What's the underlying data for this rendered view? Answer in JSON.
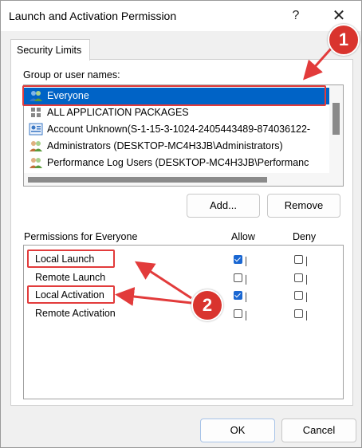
{
  "window": {
    "title": "Launch and Activation Permission",
    "help_glyph": "?",
    "close_glyph": "✕"
  },
  "tabs": [
    {
      "label": "Security Limits"
    }
  ],
  "group_section": {
    "label": "Group or user names:",
    "items": [
      {
        "label": "Everyone",
        "icon": "users-group-icon",
        "selected": true
      },
      {
        "label": "ALL APPLICATION PACKAGES",
        "icon": "packages-grid-icon",
        "selected": false
      },
      {
        "label": "Account Unknown(S-1-15-3-1024-2405443489-874036122-",
        "icon": "unknown-account-icon",
        "selected": false
      },
      {
        "label": "Administrators (DESKTOP-MC4H3JB\\Administrators)",
        "icon": "users-group-icon",
        "selected": false
      },
      {
        "label": "Performance Log Users (DESKTOP-MC4H3JB\\Performanc",
        "icon": "users-group-icon",
        "selected": false
      }
    ],
    "add_button": "Add...",
    "remove_button": "Remove"
  },
  "permissions": {
    "label": "Permissions for Everyone",
    "allow_header": "Allow",
    "deny_header": "Deny",
    "rows": [
      {
        "name": "Local Launch",
        "allow": true,
        "deny": false
      },
      {
        "name": "Remote Launch",
        "allow": false,
        "deny": false
      },
      {
        "name": "Local Activation",
        "allow": true,
        "deny": false
      },
      {
        "name": "Remote Activation",
        "allow": false,
        "deny": false
      }
    ]
  },
  "footer": {
    "ok_button": "OK",
    "cancel_button": "Cancel"
  },
  "annotations": {
    "badge_1": "1",
    "badge_2": "2",
    "color": "#e23b3b"
  }
}
